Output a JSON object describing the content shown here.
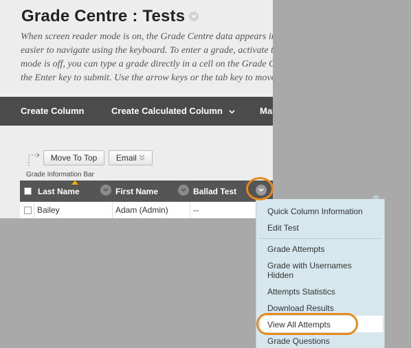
{
  "header": {
    "title": "Grade Centre : Tests",
    "description_lines": [
      "When screen reader mode is on, the Grade Centre data appears in a table, making it",
      "easier to navigate using the keyboard. To enter a grade, activate the cell. When this",
      "mode is off, you can type a grade directly in a cell on the Grade Centre and press",
      "the Enter key to submit. Use the arrow keys or the tab key to move between cells."
    ]
  },
  "action_bar": {
    "create_column": "Create Column",
    "create_calculated_column": "Create Calculated Column",
    "manage": "Manage"
  },
  "toolbar": {
    "move_to_top": "Move To Top",
    "email": "Email",
    "grade_information_bar": "Grade Information Bar"
  },
  "grid": {
    "columns": [
      "Last Name",
      "First Name",
      "Ballad Test"
    ],
    "rows": [
      {
        "last_name": "Bailey",
        "first_name": "Adam (Admin)",
        "ballad_test": "--"
      }
    ]
  },
  "context_menu": {
    "items": [
      "Quick Column Information",
      "Edit Test",
      "Grade Attempts",
      "Grade with Usernames Hidden",
      "Attempts Statistics",
      "Download Results",
      "View All Attempts",
      "Grade Questions"
    ],
    "highlighted": "View All Attempts"
  },
  "colors": {
    "highlight_ring": "#e8891c",
    "action_bar": "#4b4b4b",
    "menu_background": "#d6e7ed"
  }
}
